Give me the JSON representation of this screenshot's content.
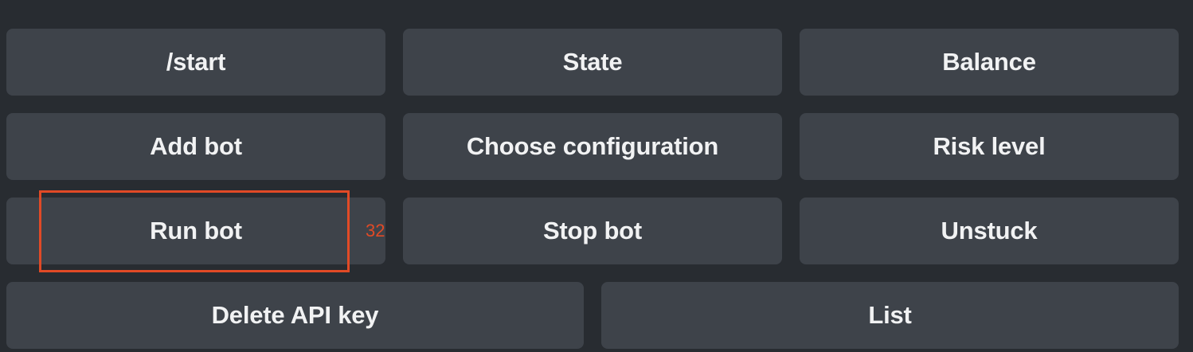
{
  "keyboard": {
    "rows": [
      [
        "/start",
        "State",
        "Balance"
      ],
      [
        "Add bot",
        "Choose configuration",
        "Risk level"
      ],
      [
        "Run bot",
        "Stop bot",
        "Unstuck"
      ],
      [
        "Delete API key",
        "List"
      ]
    ]
  },
  "annotation": {
    "label": "32",
    "color": "#e14a26"
  },
  "colors": {
    "background": "#282c31",
    "button": "#3e434a",
    "button_text": "#f1f2f3"
  }
}
